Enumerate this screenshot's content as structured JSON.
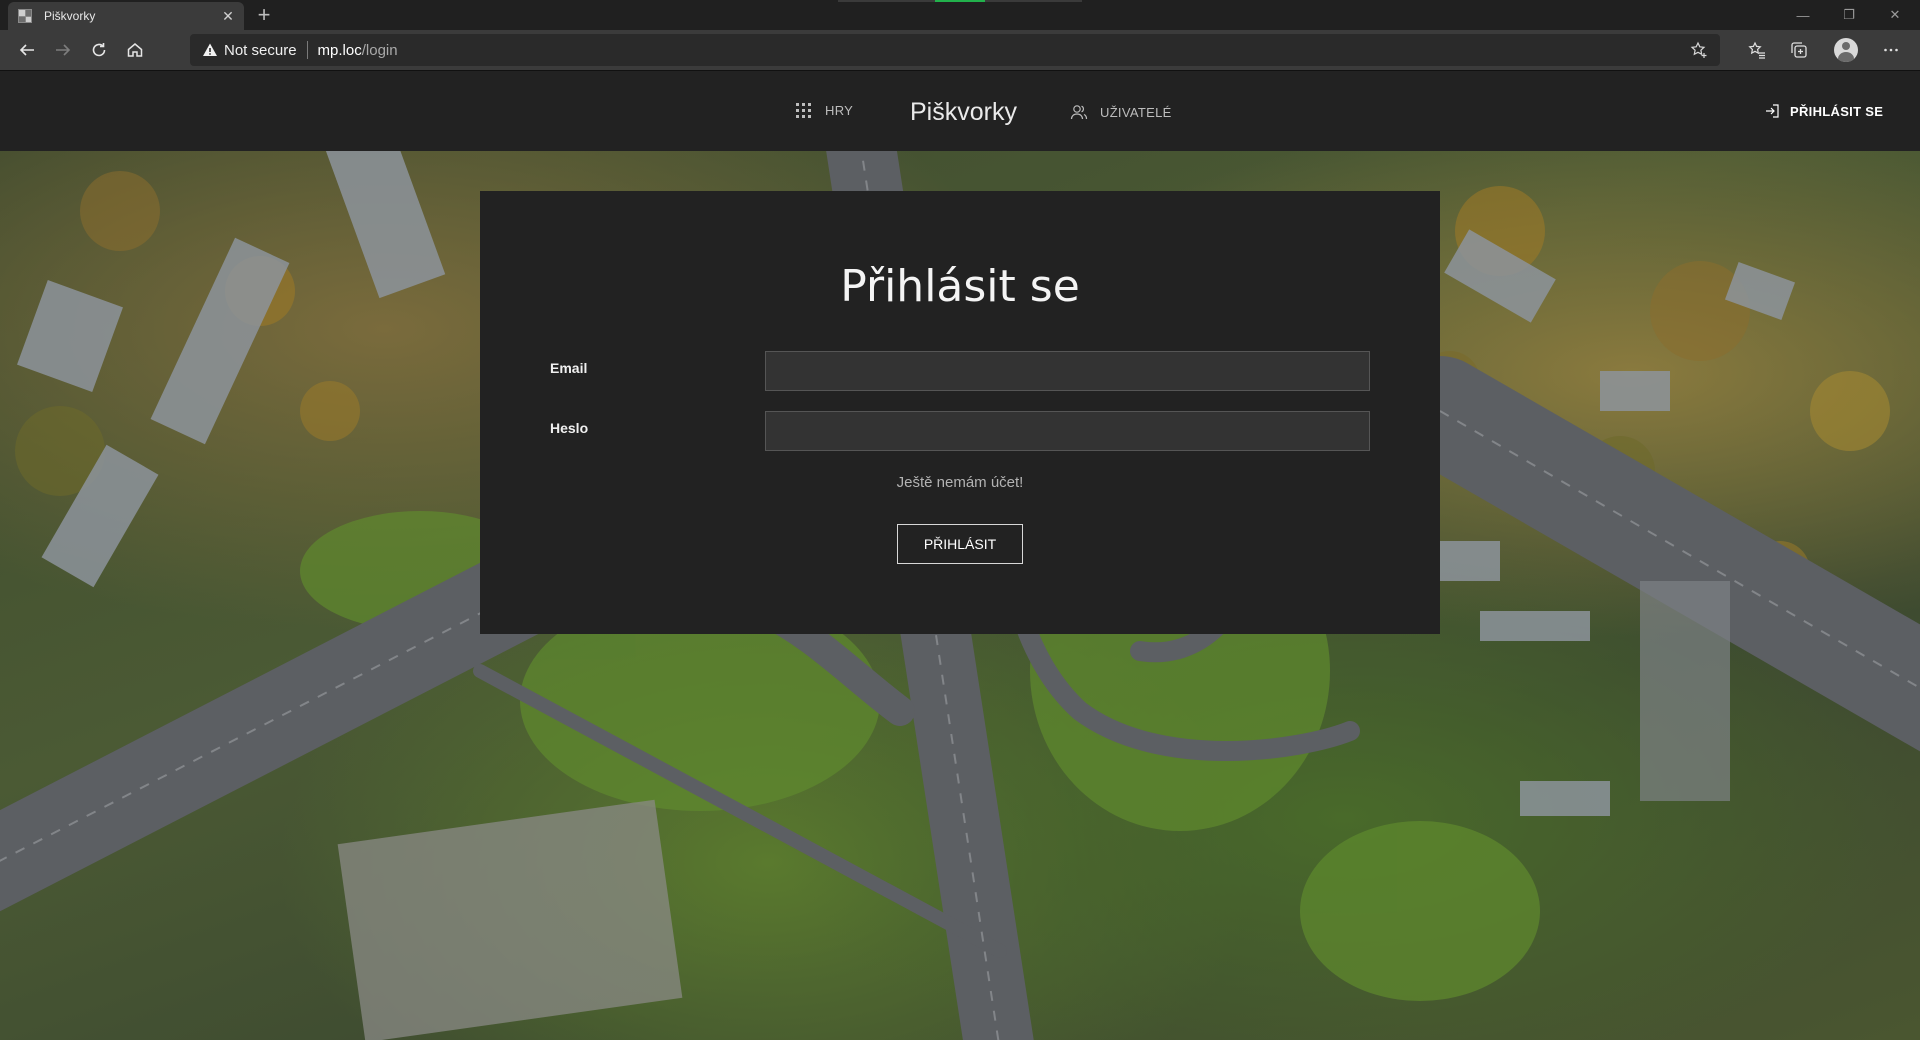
{
  "browser": {
    "tab_title": "Piškvorky",
    "tab_close": "✕",
    "new_tab": "+",
    "security_text": "Not secure",
    "url_host": "mp.loc",
    "url_path": "/login",
    "window_controls": {
      "minimize": "—",
      "maximize": "❐",
      "close": "✕"
    }
  },
  "nav": {
    "games_label": "HRY",
    "brand": "Piškvorky",
    "users_label": "UŽIVATELÉ",
    "login_label": "PŘIHLÁSIT SE"
  },
  "login_form": {
    "title": "Přihlásit se",
    "email_label": "Email",
    "email_value": "",
    "password_label": "Heslo",
    "password_value": "",
    "register_link": "Ještě nemám účet!",
    "submit_label": "PŘIHLÁSIT"
  },
  "colors": {
    "nav_bg": "#222222",
    "card_bg": "#222222",
    "input_bg": "#333333",
    "accent_green": "#22b14c"
  },
  "icons": {
    "favicon": "grid-favicon-icon",
    "back": "arrow-left-icon",
    "forward": "arrow-right-icon",
    "refresh": "refresh-icon",
    "home": "home-icon",
    "warning": "warning-triangle-icon",
    "favorite": "star-plus-icon",
    "favorites": "star-list-icon",
    "collections": "collections-icon",
    "profile": "avatar-icon",
    "more": "more-dots-icon",
    "games": "grid-dots-icon",
    "users": "users-icon",
    "login": "sign-in-icon"
  }
}
